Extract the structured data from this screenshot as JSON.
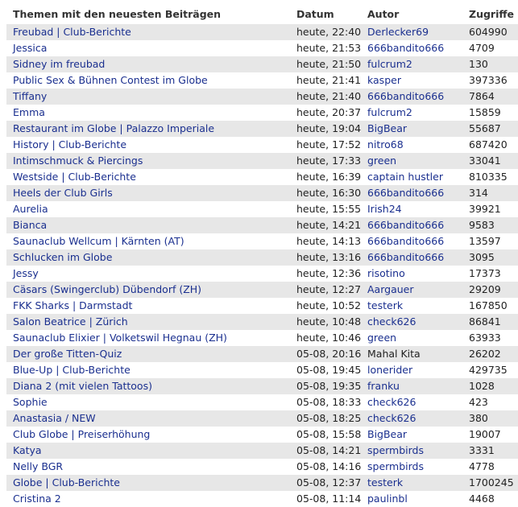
{
  "table": {
    "headers": {
      "topic": "Themen mit den neuesten Beiträgen",
      "date": "Datum",
      "author": "Autor",
      "views": "Zugriffe"
    },
    "rows": [
      {
        "topic": "Freubad | Club-Berichte",
        "date": "heute, 22:40",
        "author": "Derlecker69",
        "views": "604990"
      },
      {
        "topic": "Jessica",
        "date": "heute, 21:53",
        "author": "666bandito666",
        "views": "4709"
      },
      {
        "topic": "Sidney im freubad",
        "date": "heute, 21:50",
        "author": "fulcrum2",
        "views": "130"
      },
      {
        "topic": "Public Sex & Bühnen Contest im Globe",
        "date": "heute, 21:41",
        "author": "kasper",
        "views": "397336"
      },
      {
        "topic": "Tiffany",
        "date": "heute, 21:40",
        "author": "666bandito666",
        "views": "7864"
      },
      {
        "topic": "Emma",
        "date": "heute, 20:37",
        "author": "fulcrum2",
        "views": "15859"
      },
      {
        "topic": "Restaurant im Globe | Palazzo Imperiale",
        "date": "heute, 19:04",
        "author": "BigBear",
        "views": "55687"
      },
      {
        "topic": "History | Club-Berichte",
        "date": "heute, 17:52",
        "author": "nitro68",
        "views": "687420"
      },
      {
        "topic": "Intimschmuck & Piercings",
        "date": "heute, 17:33",
        "author": "green",
        "views": "33041"
      },
      {
        "topic": "Westside | Club-Berichte",
        "date": "heute, 16:39",
        "author": "captain hustler",
        "views": "810335"
      },
      {
        "topic": "Heels der Club Girls",
        "date": "heute, 16:30",
        "author": "666bandito666",
        "views": "314"
      },
      {
        "topic": "Aurelia",
        "date": "heute, 15:55",
        "author": "Irish24",
        "views": "39921"
      },
      {
        "topic": "Bianca",
        "date": "heute, 14:21",
        "author": "666bandito666",
        "views": "9583"
      },
      {
        "topic": "Saunaclub Wellcum | Kärnten (AT)",
        "date": "heute, 14:13",
        "author": "666bandito666",
        "views": "13597"
      },
      {
        "topic": "Schlucken im Globe",
        "date": "heute, 13:16",
        "author": "666bandito666",
        "views": "3095"
      },
      {
        "topic": "Jessy",
        "date": "heute, 12:36",
        "author": "risotino",
        "views": "17373"
      },
      {
        "topic": "Cäsars (Swingerclub) Dübendorf (ZH)",
        "date": "heute, 12:27",
        "author": "Aargauer",
        "views": "29209"
      },
      {
        "topic": "FKK Sharks | Darmstadt",
        "date": "heute, 10:52",
        "author": "testerk",
        "views": "167850"
      },
      {
        "topic": "Salon Beatrice | Zürich",
        "date": "heute, 10:48",
        "author": "check626",
        "views": "86841"
      },
      {
        "topic": "Saunaclub Elixier | Volketswil Hegnau (ZH)",
        "date": "heute, 10:46",
        "author": "green",
        "views": "63933"
      },
      {
        "topic": "Der große Titten-Quiz",
        "date": "05-08, 20:16",
        "author": "Mahal Kita",
        "views": "26202",
        "author_plain": true
      },
      {
        "topic": "Blue-Up | Club-Berichte",
        "date": "05-08, 19:45",
        "author": "lonerider",
        "views": "429735"
      },
      {
        "topic": "Diana 2 (mit vielen Tattoos)",
        "date": "05-08, 19:35",
        "author": "franku",
        "views": "1028"
      },
      {
        "topic": "Sophie",
        "date": "05-08, 18:33",
        "author": "check626",
        "views": "423"
      },
      {
        "topic": "Anastasia / NEW",
        "date": "05-08, 18:25",
        "author": "check626",
        "views": "380"
      },
      {
        "topic": "Club Globe | Preiserhöhung",
        "date": "05-08, 15:58",
        "author": "BigBear",
        "views": "19007"
      },
      {
        "topic": "Katya",
        "date": "05-08, 14:21",
        "author": "spermbirds",
        "views": "3331"
      },
      {
        "topic": "Nelly BGR",
        "date": "05-08, 14:16",
        "author": "spermbirds",
        "views": "4778"
      },
      {
        "topic": "Globe | Club-Berichte",
        "date": "05-08, 12:37",
        "author": "testerk",
        "views": "1700245"
      },
      {
        "topic": "Cristina 2",
        "date": "05-08, 11:14",
        "author": "paulinbl",
        "views": "4468"
      }
    ]
  },
  "colors": {
    "link": "#1a2f8f",
    "row_alt": "#e7e7e7",
    "text": "#222222"
  }
}
